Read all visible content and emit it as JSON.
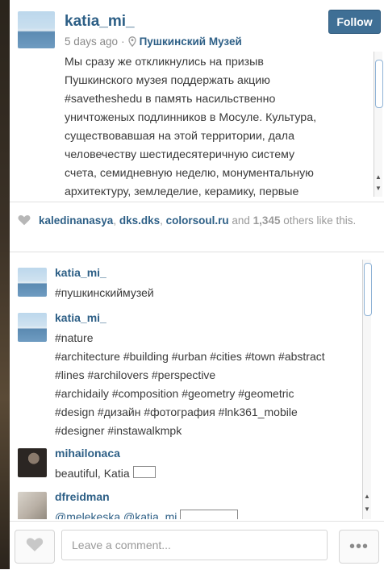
{
  "post": {
    "username": "katia_mi_",
    "follow_label": "Follow",
    "time": "5 days ago",
    "separator": "·",
    "location": "Пушкинский Музей",
    "caption": "Мы сразу же откликнулись на призыв\nПушкинского музея поддержать акцию\n#savetheshedu в память насильственно\nуничтоженых подлинников в Мосуле. Культура,\nсуществовавшая на этой территории, дала\nчеловечеству шестидесятеричную систему\nсчета, семидневную неделю, монументальную\nархитектуру, земледелие, керамику, первые"
  },
  "likes": {
    "users": [
      "kaledinanasya",
      "dks.dks",
      "colorsoul.ru"
    ],
    "sep": ", ",
    "and": " and ",
    "count": "1,345",
    "suffix": " others like this."
  },
  "comments": [
    {
      "user": "katia_mi_",
      "text": "#пушкинскиймузей"
    },
    {
      "user": "katia_mi_",
      "text": "#nature\n#architecture #building #urban #cities #town #abstract\n#lines #archilovers #perspective\n#archidaily #composition #geometry #geometric\n#design #дизайн #фотография #lnk361_mobile\n#designer #instawalkmpk"
    },
    {
      "user": "mihailonaca",
      "text": "beautiful, Katia"
    },
    {
      "user": "dfreidman",
      "mention1": "@melekeska",
      "mention2": "@katia_mi"
    }
  ],
  "footer": {
    "comment_placeholder": "Leave a comment...",
    "more_label": "•••"
  },
  "colors": {
    "link": "#2d5f86",
    "follow_bg": "#3f6f95"
  }
}
